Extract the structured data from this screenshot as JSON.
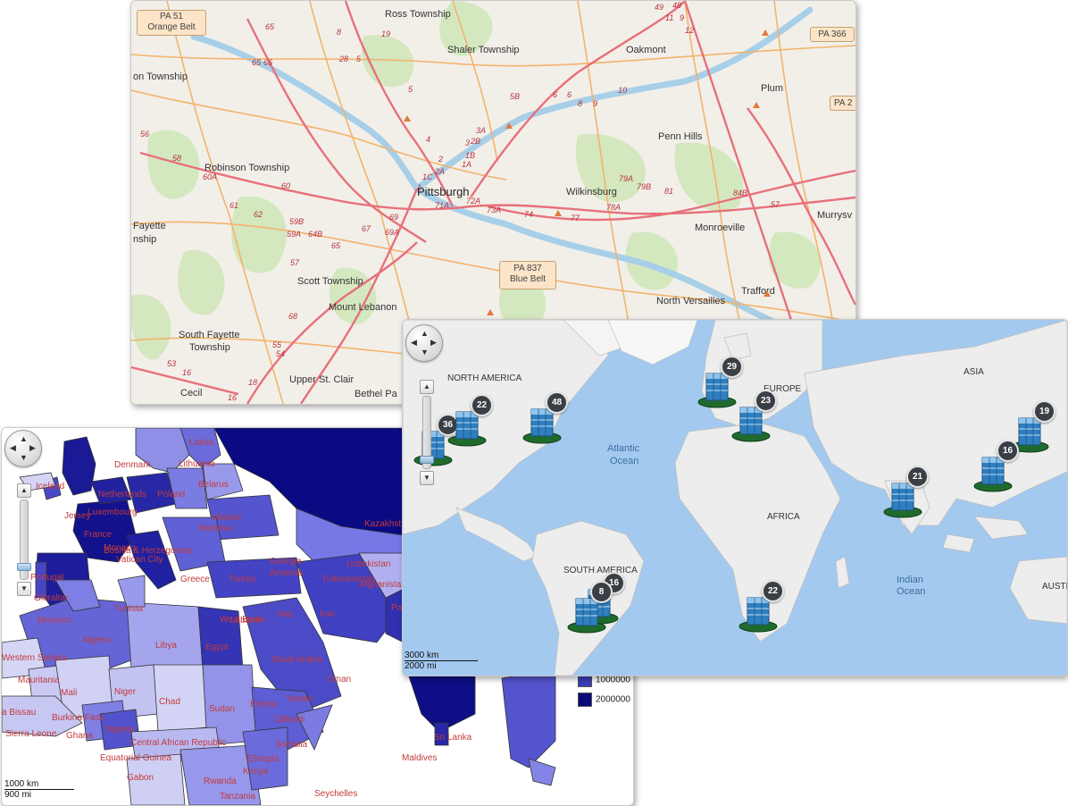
{
  "pittsburgh_map": {
    "places": [
      "Ross Township",
      "Shaler Township",
      "Oakmont",
      "Plum",
      "Penn Hills",
      "Pittsburgh",
      "Wilkinsburg",
      "Robinson Township",
      "Fayette",
      "nship",
      "Monroeville",
      "Murrysv",
      "Scott Township",
      "Mount Lebanon",
      "North Versailles",
      "Trafford",
      "South Fayette",
      "Township",
      "Upper St. Clair",
      "Bethel Pa",
      "Cecil",
      "on Township"
    ],
    "route_numbers": [
      "8",
      "65",
      "66",
      "65",
      "19",
      "28",
      "5",
      "5",
      "4",
      "3",
      "2",
      "2A",
      "1C",
      "1",
      "5B",
      "6",
      "6",
      "8",
      "9",
      "10",
      "3A",
      "2B",
      "1B",
      "1A",
      "71A",
      "72A",
      "73A",
      "74",
      "77",
      "79A",
      "78A",
      "79B",
      "81",
      "84B",
      "57",
      "56",
      "58",
      "60A",
      "60",
      "61",
      "62",
      "59B",
      "59A",
      "64B",
      "65",
      "57",
      "67",
      "69",
      "69A",
      "68",
      "55",
      "54",
      "53",
      "16",
      "16",
      "18",
      "49",
      "11",
      "48",
      "9",
      "12"
    ],
    "shields": [
      {
        "line1": "PA 51",
        "line2": "Orange Belt"
      },
      {
        "line1": "PA 366",
        "line2": ""
      },
      {
        "line1": "PA 2",
        "line2": ""
      },
      {
        "line1": "PA 837",
        "line2": "Blue Belt"
      }
    ]
  },
  "africa_map": {
    "countries": [
      "Iceland",
      "Latvia",
      "Lithuania",
      "Denmark",
      "Belarus",
      "Poland",
      "Netherlands",
      "Luxembourg",
      "Jersey",
      "Ukraine",
      "France",
      "Moldova",
      "Monaco",
      "Bosnia & Herzegovina",
      "Vatican City",
      "Kazakhst",
      "Georgia",
      "Portugal",
      "Armenia",
      "Uzbekistan",
      "Turkmenistan",
      "Greece",
      "Turkey",
      "Gibraltar",
      "Tunisia",
      "Lebanon",
      "Iraq",
      "Afghanista",
      "West Bank",
      "Iran",
      "Morocco",
      "Algeria",
      "Libya",
      "Egypt",
      "Saudi Arabia",
      "Western Sahara",
      "Oman",
      "Mauritania",
      "Mali",
      "Niger",
      "Chad",
      "Sudan",
      "Eritrea",
      "Yemen",
      "Burkina Faso",
      "Djibouti",
      "Sierra Leone",
      "Ghana",
      "Nigeria",
      "Ethiopia",
      "Somalia",
      "Central African Republic",
      "Sri Lanka",
      "Maldives",
      "Equatorial Guinea",
      "Gabon",
      "Kenya",
      "Rwanda",
      "Tanzania",
      "Seychelles",
      "a Bissau",
      "Pakis"
    ],
    "legend": [
      {
        "label": "1000000",
        "color": "#3c3cb8"
      },
      {
        "label": "2000000",
        "color": "#0a0a78"
      }
    ],
    "scale_km": "1000 km",
    "scale_mi": "900 mi"
  },
  "world_map": {
    "regions": [
      "NORTH AMERICA",
      "EUROPE",
      "ASIA",
      "AFRICA",
      "SOUTH AMERICA",
      "AUSTRA"
    ],
    "oceans": [
      {
        "line1": "Atlantic",
        "line2": "Ocean"
      },
      {
        "line1": "Indian",
        "line2": "Ocean"
      }
    ],
    "clusters": [
      "36",
      "22",
      "48",
      "29",
      "23",
      "19",
      "21",
      "16",
      "8",
      "22",
      "16"
    ],
    "scale_km": "3000 km",
    "scale_mi": "2000 mi"
  },
  "nav_icons": {
    "up": "▲",
    "down": "▼",
    "left": "◀",
    "right": "▶"
  },
  "zoom_icons": {
    "in": "▲",
    "out": "▼"
  },
  "colors": {
    "road_major": "#e8707a",
    "road_minor": "#f3b36b",
    "river": "#a8cfe8",
    "ocean": "#a3c9ef",
    "land": "#ececec",
    "cluster_badge": "#3a3f45",
    "platform": "#1f6b2c"
  }
}
